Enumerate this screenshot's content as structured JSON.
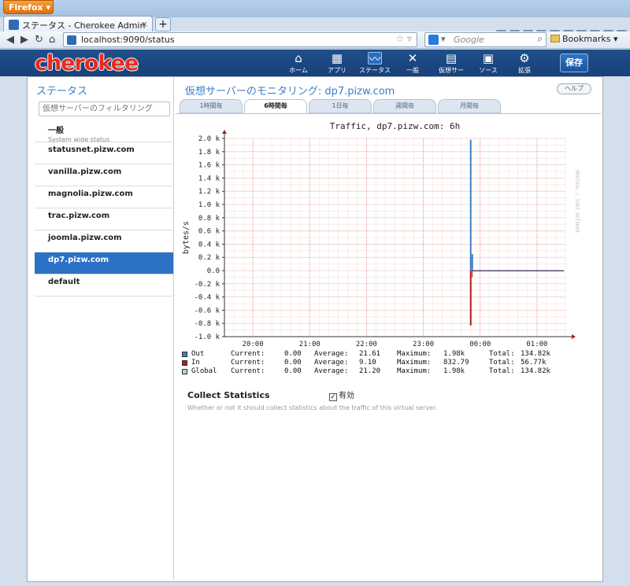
{
  "browser": {
    "menu_label": "Firefox",
    "tab_title": "ステータス - Cherokee Admin",
    "url": "localhost:9090/status",
    "search_placeholder": "Google",
    "bookmarks_label": "Bookmarks"
  },
  "app": {
    "logo": "cherokee",
    "nav": [
      {
        "label": "ホーム",
        "icon": "home-icon"
      },
      {
        "label": "アプリ",
        "icon": "apps-icon"
      },
      {
        "label": "ステータス",
        "icon": "status-icon"
      },
      {
        "label": "一般",
        "icon": "tools-icon"
      },
      {
        "label": "仮想サー",
        "icon": "vserver-icon"
      },
      {
        "label": "ソース",
        "icon": "source-icon"
      },
      {
        "label": "拡張",
        "icon": "gear-icon"
      }
    ],
    "active_nav": "ステータス",
    "save_label": "保存"
  },
  "sidebar": {
    "title": "ステータス",
    "filter_placeholder": "仮想サーバーのフィルタリング",
    "items": [
      {
        "label": "一般",
        "sub": "System wide status"
      },
      {
        "label": "statusnet.pizw.com"
      },
      {
        "label": "vanilla.pizw.com"
      },
      {
        "label": "magnolia.pizw.com"
      },
      {
        "label": "trac.pizw.com"
      },
      {
        "label": "joomla.pizw.com"
      },
      {
        "label": "dp7.pizw.com"
      },
      {
        "label": "default"
      }
    ],
    "selected": "dp7.pizw.com"
  },
  "main": {
    "title": "仮想サーバーのモニタリング: dp7.pizw.com",
    "help_label": "ヘルプ",
    "tabs": [
      "1時間毎",
      "6時間毎",
      "1日毎",
      "週間毎",
      "月間毎"
    ],
    "active_tab": "6時間毎",
    "collect_label": "Collect Statistics",
    "checkbox_label": "有効",
    "checkbox_checked": true,
    "hint": "Whether or not it should collect statistics about the traffic of this virtual server."
  },
  "chart_data": {
    "type": "line",
    "title": "Traffic, dp7.pizw.com: 6h",
    "ylabel": "bytes/s",
    "side_label": "RRDTOOL / TOBI OETIKER",
    "ylim": [
      -1.0,
      2.0
    ],
    "y_ticks": [
      "2.0 k",
      "1.8 k",
      "1.6 k",
      "1.4 k",
      "1.2 k",
      "1.0 k",
      "0.8 k",
      "0.6 k",
      "0.4 k",
      "0.2 k",
      "0.0",
      "-0.2 k",
      "-0.4 k",
      "-0.6 k",
      "-0.8 k",
      "-1.0 k"
    ],
    "x_ticks": [
      "20:00",
      "21:00",
      "22:00",
      "23:00",
      "00:00",
      "01:00"
    ],
    "series": [
      {
        "name": "Out",
        "color": "#3d7fc4",
        "current": "0.00",
        "average": "21.61",
        "maximum": "1.98k",
        "total": "134.82k"
      },
      {
        "name": "In",
        "color": "#b01919",
        "current": "0.00",
        "average": "9.10",
        "maximum": "832.79",
        "total": "56.77k"
      },
      {
        "name": "Global",
        "color": "#a9d4e8",
        "current": "0.00",
        "average": "21.20",
        "maximum": "1.98k",
        "total": "134.82k"
      }
    ],
    "legend_keys": {
      "current": "Current:",
      "average": "Average:",
      "maximum": "Maximum:",
      "total": "Total:"
    },
    "spike_time": "23:50",
    "spike_values": {
      "Out": 1.98,
      "In": -0.83,
      "Global": 0.25
    },
    "steady_value": 0.0,
    "grid": true
  }
}
